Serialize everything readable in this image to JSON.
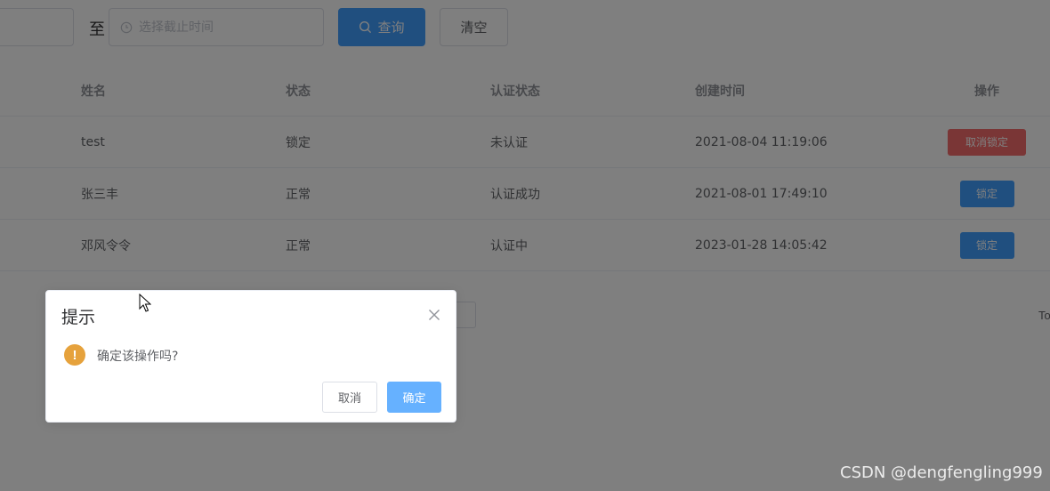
{
  "filter": {
    "range_separator": "至",
    "end_placeholder": "选择截止时间",
    "query_label": "查询",
    "clear_label": "清空"
  },
  "table": {
    "headers": [
      "姓名",
      "状态",
      "认证状态",
      "创建时间",
      "操作"
    ],
    "rows": [
      {
        "name": "test",
        "status": "锁定",
        "auth": "未认证",
        "created": "2021-08-04 11:19:06",
        "action": "取消锁定"
      },
      {
        "name": "张三丰",
        "status": "正常",
        "auth": "认证成功",
        "created": "2021-08-01 17:49:10",
        "action": "锁定"
      },
      {
        "name": "邓风令令",
        "status": "正常",
        "auth": "认证中",
        "created": "2023-01-28 14:05:42",
        "action": "锁定"
      }
    ]
  },
  "pagination": {
    "total_partial": "To"
  },
  "dialog": {
    "title": "提示",
    "message": "确定该操作吗?",
    "warning_symbol": "!",
    "cancel_label": "取消",
    "confirm_label": "确定"
  },
  "watermark": "CSDN @dengfengling999",
  "colors": {
    "primary": "#409eff",
    "danger": "#f56c6c",
    "warning": "#e6a23c",
    "confirm_light": "#66b1ff"
  }
}
